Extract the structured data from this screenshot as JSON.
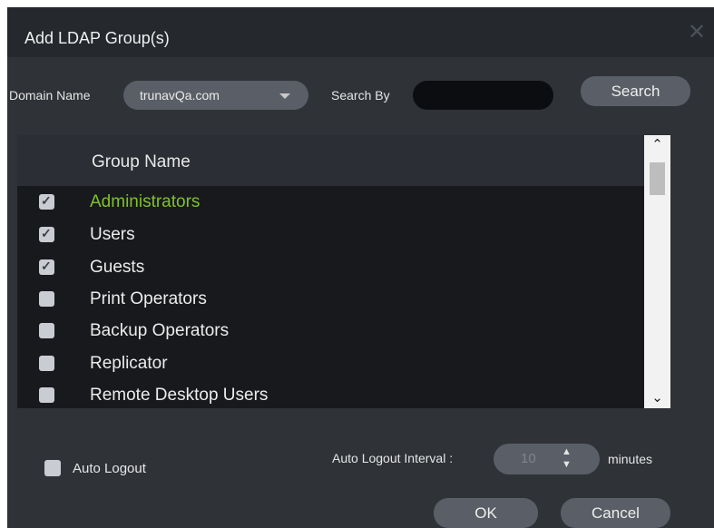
{
  "dialog": {
    "title": "Add LDAP Group(s)",
    "close_icon": "close-icon"
  },
  "filters": {
    "domain_label": "Domain Name",
    "domain_value": "trunavQa.com",
    "search_by_label": "Search By",
    "search_value": "",
    "search_button": "Search"
  },
  "grid": {
    "header": "Group Name",
    "rows": [
      {
        "name": "Administrators",
        "checked": true,
        "selected": true
      },
      {
        "name": "Users",
        "checked": true,
        "selected": false
      },
      {
        "name": "Guests",
        "checked": true,
        "selected": false
      },
      {
        "name": "Print Operators",
        "checked": false,
        "selected": false
      },
      {
        "name": "Backup Operators",
        "checked": false,
        "selected": false
      },
      {
        "name": "Replicator",
        "checked": false,
        "selected": false
      },
      {
        "name": "Remote Desktop Users",
        "checked": false,
        "selected": false
      }
    ]
  },
  "footer": {
    "auto_logout_label": "Auto Logout",
    "auto_logout_checked": false,
    "interval_label": "Auto Logout Interval :",
    "interval_value": "10",
    "interval_unit": "minutes",
    "ok_button": "OK",
    "cancel_button": "Cancel"
  },
  "colors": {
    "dialog_bg": "#2f3237",
    "titlebar_bg": "#25282d",
    "selected_text": "#7fc22a",
    "button_bg": "#5a5e66"
  }
}
